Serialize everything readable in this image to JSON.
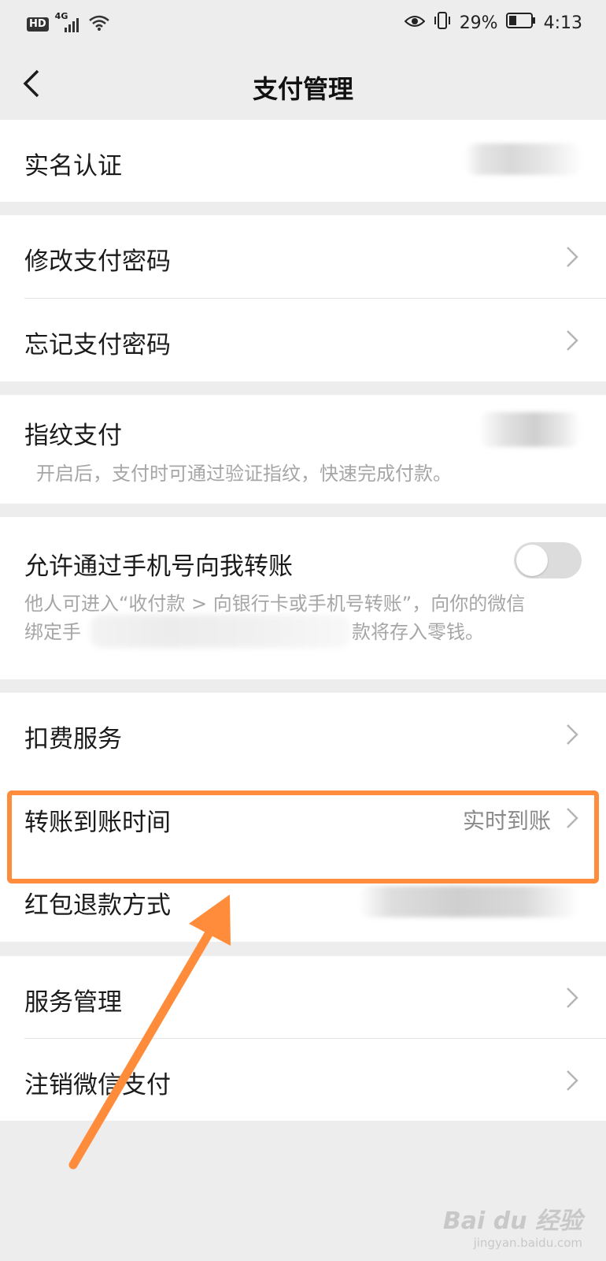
{
  "status_bar": {
    "hd": "HD",
    "network": "4G",
    "battery": "29%",
    "time": "4:13"
  },
  "navbar": {
    "title": "支付管理"
  },
  "rows": {
    "real_name": "实名认证",
    "change_password": "修改支付密码",
    "forgot_password": "忘记支付密码",
    "fingerprint": "指纹支付",
    "fingerprint_desc": "开启后，支付时可通过验证指纹，快速完成付款。",
    "phone_transfer": "允许通过手机号向我转账",
    "phone_transfer_desc_1": "他人可进入“收付款 > 向银行卡或手机号转账”，向你的微信",
    "phone_transfer_desc_2a": "绑定手",
    "phone_transfer_desc_2b": "款将存入零钱。",
    "deduction_service": "扣费服务",
    "transfer_time": "转账到账时间",
    "transfer_time_value": "实时到账",
    "red_packet_refund": "红包退款方式",
    "service_management": "服务管理",
    "cancel_wechat_pay": "注销微信支付"
  },
  "toggles": {
    "phone_transfer_enabled": false
  },
  "watermark": {
    "logo": "Bai du 经验",
    "sub": "jingyan.baidu.com"
  },
  "colors": {
    "highlight": "#ff8c3a",
    "background": "#ededed"
  }
}
